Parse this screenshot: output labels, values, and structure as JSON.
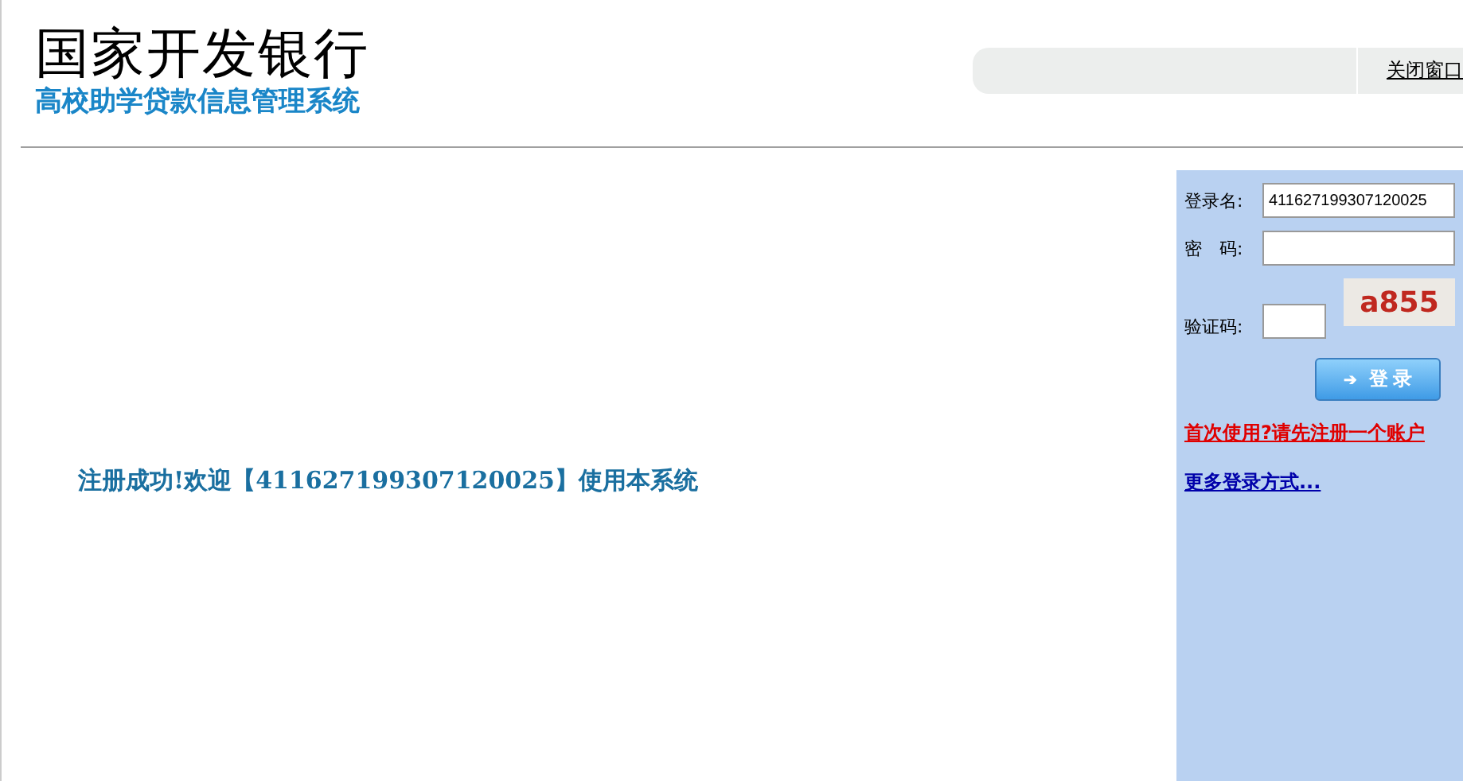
{
  "header": {
    "title": "国家开发银行",
    "subtitle": "高校助学贷款信息管理系统",
    "close_link": "关闭窗口"
  },
  "message": "注册成功!欢迎【411627199307120025】使用本系统",
  "login": {
    "username_label": "登录名:",
    "username_value": "411627199307120025",
    "password_label": "密　码:",
    "captcha_label": "验证码:",
    "captcha": "a855",
    "button_icon": "➔",
    "button": "登 录",
    "register_link": "首次使用?请先注册一个账户",
    "more_link": "更多登录方式..."
  }
}
